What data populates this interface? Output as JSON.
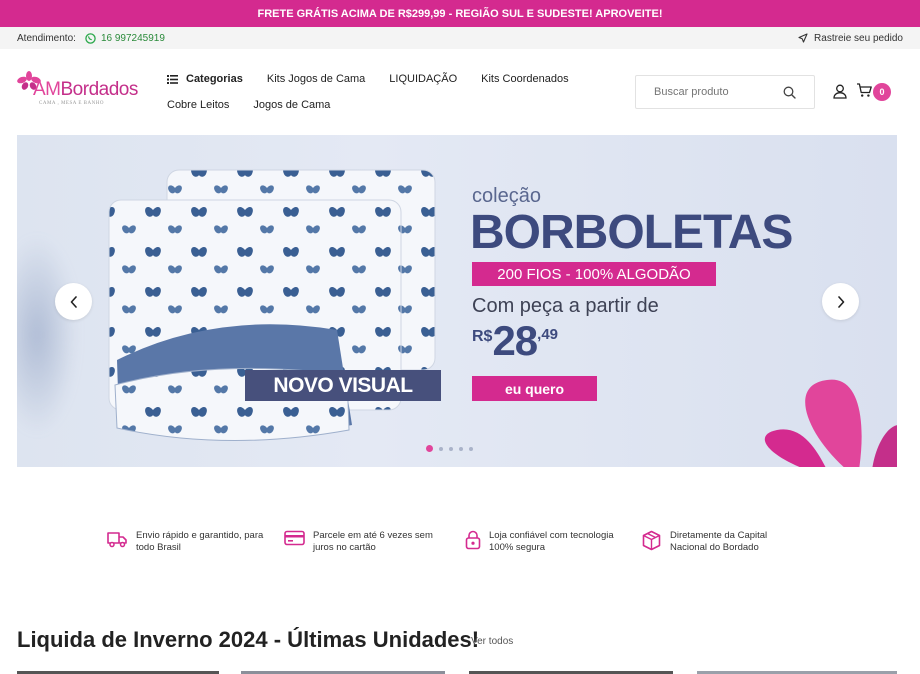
{
  "topbar": {
    "text": "FRETE GRÁTIS ACIMA DE R$299,99 - REGIÃO SUL E SUDESTE! APROVEITE!"
  },
  "infobar": {
    "support_label": "Atendimento:",
    "phone": "16 997245919",
    "track_label": "Rastreie seu pedido"
  },
  "brand": {
    "name_am": "AM",
    "name_rest": "Bordados",
    "tagline": "CAMA , MESA E BANHO",
    "accent": "#d42a8f",
    "navy": "#3d4a7e"
  },
  "nav": {
    "row1": [
      "Categorias",
      "Kits Jogos de Cama",
      "LIQUIDAÇÃO",
      "Kits Coordenados"
    ],
    "row2": [
      "Cobre Leitos",
      "Jogos de Cama"
    ]
  },
  "search": {
    "placeholder": "Buscar produto"
  },
  "cart": {
    "count": "0"
  },
  "banner": {
    "pre_title": "coleção",
    "title": "BORBOLETAS",
    "strip": "200 FIOS - 100% ALGODÃO",
    "subtitle": "Com peça a partir de",
    "price_currency": "R$",
    "price_int": "28",
    "price_dec": ",49",
    "cta": "eu quero",
    "product_tag": "NOVO VISUAL"
  },
  "features": [
    {
      "line1": "Envio rápido e garantido, para",
      "line2": "todo Brasil",
      "icon": "truck-icon"
    },
    {
      "line1": "Parcele em até 6 vezes sem",
      "line2": "juros no cartão",
      "icon": "credit-card-icon"
    },
    {
      "line1": "Loja confiável com tecnologia",
      "line2": "100% segura",
      "icon": "lock-icon"
    },
    {
      "line1": "Diretamente da Capital",
      "line2": "Nacional do Bordado",
      "icon": "box-icon"
    }
  ],
  "section": {
    "title": "Liquida de Inverno 2024 - Últimas Unidades!",
    "see_all": "Ver todos"
  }
}
